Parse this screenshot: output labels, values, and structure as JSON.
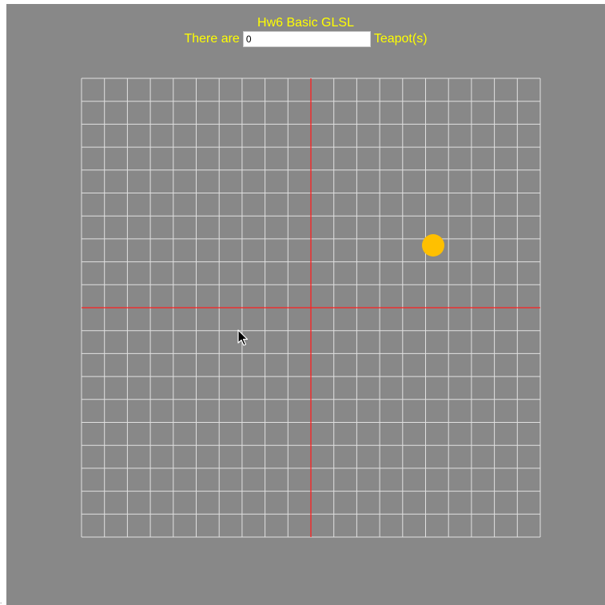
{
  "header": {
    "title": "Hw6 Basic GLSL",
    "prefix_label": "There are",
    "suffix_label": "Teapot(s)"
  },
  "teapot_count": {
    "value": "0"
  },
  "scene": {
    "grid_divisions": 20,
    "grid_color": "#e0e0e0",
    "axis_color": "#ff2020",
    "light_color": "#ffc000",
    "background_color": "#888888",
    "title_color": "#ffff00",
    "cursor_icon": "mouse-pointer-icon"
  }
}
